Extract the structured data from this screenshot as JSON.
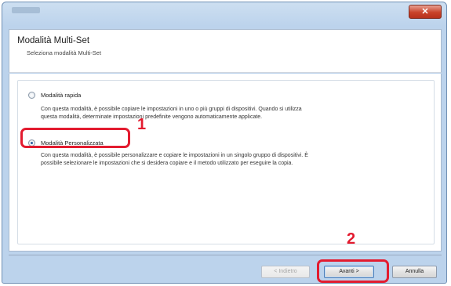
{
  "window": {
    "close_label": "✕"
  },
  "header": {
    "title": "Modalità Multi-Set",
    "subtitle": "Seleziona modalità Multi-Set"
  },
  "options": [
    {
      "label": "Modalità rapida",
      "selected": false,
      "description_line1": "Con questa modalità, è possibile copiare le impostazioni in uno o più gruppi di dispositivi. Quando si utilizza",
      "description_line2": "questa modalità, determinate impostazioni predefinite vengono automaticamente applicate."
    },
    {
      "label": "Modalità Personalizzata",
      "selected": true,
      "description_line1": "Con questa modalità, è possibile personalizzare e copiare le impostazioni in un singolo gruppo di dispositivi. È",
      "description_line2": "possibile selezionare le impostazioni che si desidera copiare e il metodo utilizzato per eseguire la copia."
    }
  ],
  "callouts": {
    "step1": "1",
    "step2": "2",
    "color": "#e31b2f"
  },
  "footer": {
    "back_label": "< Indietro",
    "next_label": "Avanti >",
    "cancel_label": "Annulla"
  }
}
